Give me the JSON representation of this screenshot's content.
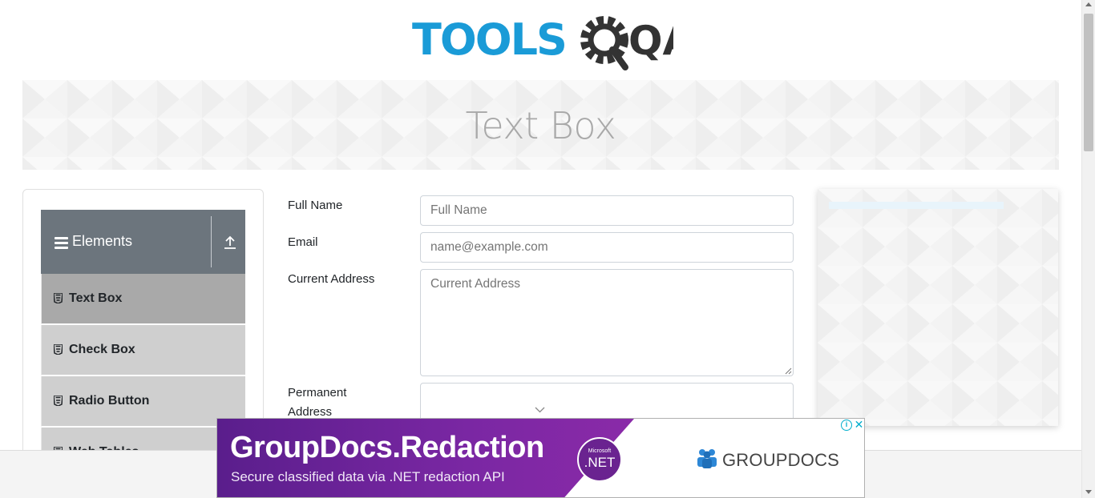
{
  "logo": {
    "text_left": "TOOLS",
    "text_right": "QA",
    "color_blue": "#1a9bd7",
    "color_dark": "#333333"
  },
  "banner": {
    "title": "Text Box"
  },
  "sidebar": {
    "group_title": "Elements",
    "items": [
      {
        "label": "Text Box",
        "active": true
      },
      {
        "label": "Check Box",
        "active": false
      },
      {
        "label": "Radio Button",
        "active": false
      },
      {
        "label": "Web Tables",
        "active": false
      }
    ]
  },
  "form": {
    "full_name": {
      "label": "Full Name",
      "placeholder": "Full Name",
      "value": ""
    },
    "email": {
      "label": "Email",
      "placeholder": "name@example.com",
      "value": ""
    },
    "current_address": {
      "label": "Current Address",
      "placeholder": "Current Address",
      "value": ""
    },
    "permanent_address": {
      "label_line1": "Permanent",
      "label_line2": "Address",
      "value": ""
    }
  },
  "bottom_ad": {
    "title": "GroupDocs.Redaction",
    "subtitle": "Secure classified data via .NET redaction API",
    "badge_small": "Microsoft",
    "badge_big": ".NET",
    "brand": "GROUPDOCS",
    "info_glyph": "i",
    "close_glyph": "✕"
  },
  "colors": {
    "sidebar_header": "#6c757d",
    "sidebar_item": "#cfcfcf",
    "sidebar_item_active": "#a9a9a9",
    "ad_purple": "#6f2399"
  }
}
